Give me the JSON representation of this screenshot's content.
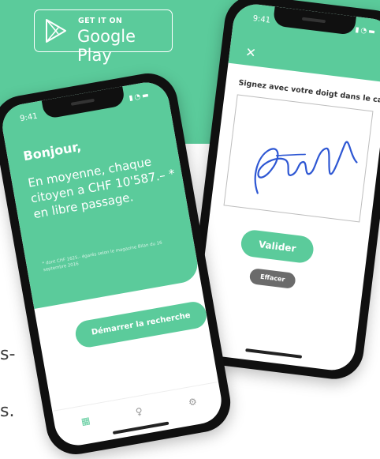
{
  "colors": {
    "brand_green": "#5bcb9b",
    "button_gray": "#6b6b6b",
    "signature_blue": "#2e57d3"
  },
  "store_badge": {
    "small": "GET IT ON",
    "big": "Google Play",
    "icon": "play-store-icon"
  },
  "side_text": [
    "s-",
    "s."
  ],
  "right_phone": {
    "status_time": "9:41",
    "close": "✕",
    "instruction": "Signez avec votre doigt dans le carré.",
    "primary_button": "Valider",
    "secondary_button": "Effacer"
  },
  "left_phone": {
    "status_time": "9:41",
    "greeting": "Bonjour,",
    "headline": "En moyenne, chaque citoyen a CHF 10'587.– * en libre passage.",
    "footnote": "* dont CHF 1625.- égarés selon le magazine Bilan du 16 septembre 2016",
    "cta_button": "Démarrer la recherche",
    "tabs": [
      "grid-icon",
      "user-icon",
      "settings-icon"
    ]
  }
}
